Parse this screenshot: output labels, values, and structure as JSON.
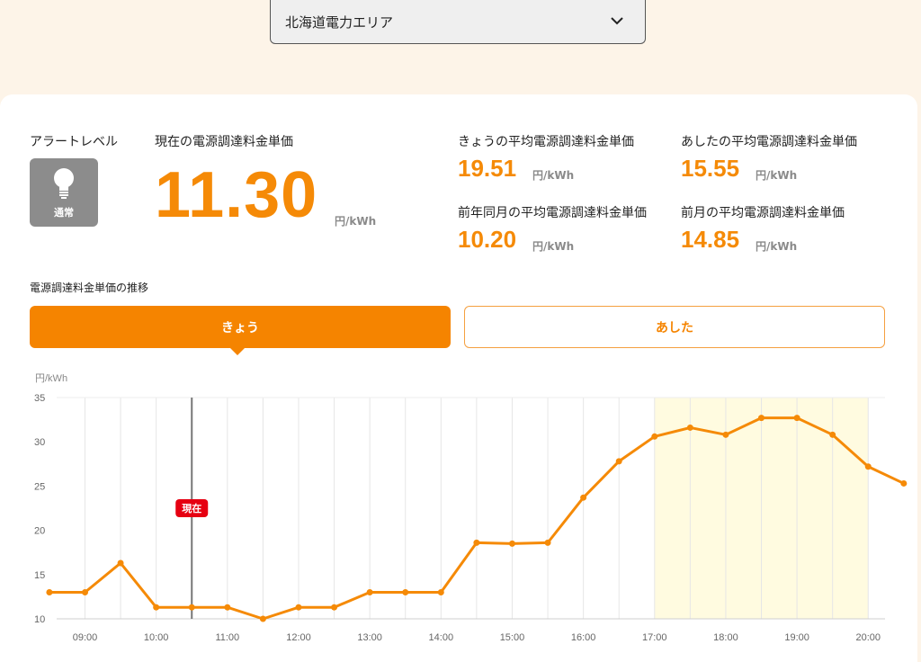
{
  "area_select": {
    "value": "北海道電力エリア",
    "icon": "chevron-down-icon"
  },
  "alert": {
    "label": "アラートレベル",
    "status": "通常",
    "icon": "lightbulb-icon",
    "color": "#8c8c8c"
  },
  "current": {
    "label": "現在の電源調達料金単価",
    "value": "11.30",
    "unit": "円/kWh"
  },
  "averages": [
    {
      "label": "きょうの平均電源調達料金単価",
      "value": "19.51",
      "unit": "円/kWh"
    },
    {
      "label": "あしたの平均電源調達料金単価",
      "value": "15.55",
      "unit": "円/kWh"
    },
    {
      "label": "前年同月の平均電源調達料金単価",
      "value": "10.20",
      "unit": "円/kWh"
    },
    {
      "label": "前月の平均電源調達料金単価",
      "value": "14.85",
      "unit": "円/kWh"
    }
  ],
  "section_title": "電源調達料金単価の推移",
  "tabs": {
    "today": "きょう",
    "tomorrow": "あした"
  },
  "colors": {
    "accent": "#f58a07",
    "highlight": "#fffbe0",
    "now_badge": "#e60012"
  },
  "chart_data": {
    "type": "line",
    "y_unit": "円/kWh",
    "ylim": [
      10,
      35
    ],
    "y_ticks": [
      10,
      15,
      20,
      25,
      30,
      35
    ],
    "x_ticks": [
      "09:00",
      "10:00",
      "11:00",
      "12:00",
      "13:00",
      "14:00",
      "15:00",
      "16:00",
      "17:00",
      "18:00",
      "19:00",
      "20:00"
    ],
    "x": [
      "08:30",
      "09:00",
      "09:30",
      "10:00",
      "10:30",
      "11:00",
      "11:30",
      "12:00",
      "12:30",
      "13:00",
      "13:30",
      "14:00",
      "14:30",
      "15:00",
      "15:30",
      "16:00",
      "16:30",
      "17:00",
      "17:30",
      "18:00",
      "18:30",
      "19:00",
      "19:30",
      "20:00",
      "20:30"
    ],
    "values": [
      13.0,
      13.0,
      16.3,
      11.3,
      11.3,
      11.3,
      10.0,
      11.3,
      11.3,
      13.0,
      13.0,
      13.0,
      18.6,
      18.5,
      18.6,
      23.7,
      27.8,
      30.6,
      31.6,
      30.8,
      32.7,
      32.7,
      30.8,
      27.2,
      25.3
    ],
    "now": {
      "label": "現在",
      "time": "10:30"
    },
    "highlight_range": [
      "17:00",
      "20:00"
    ],
    "grid": true
  }
}
